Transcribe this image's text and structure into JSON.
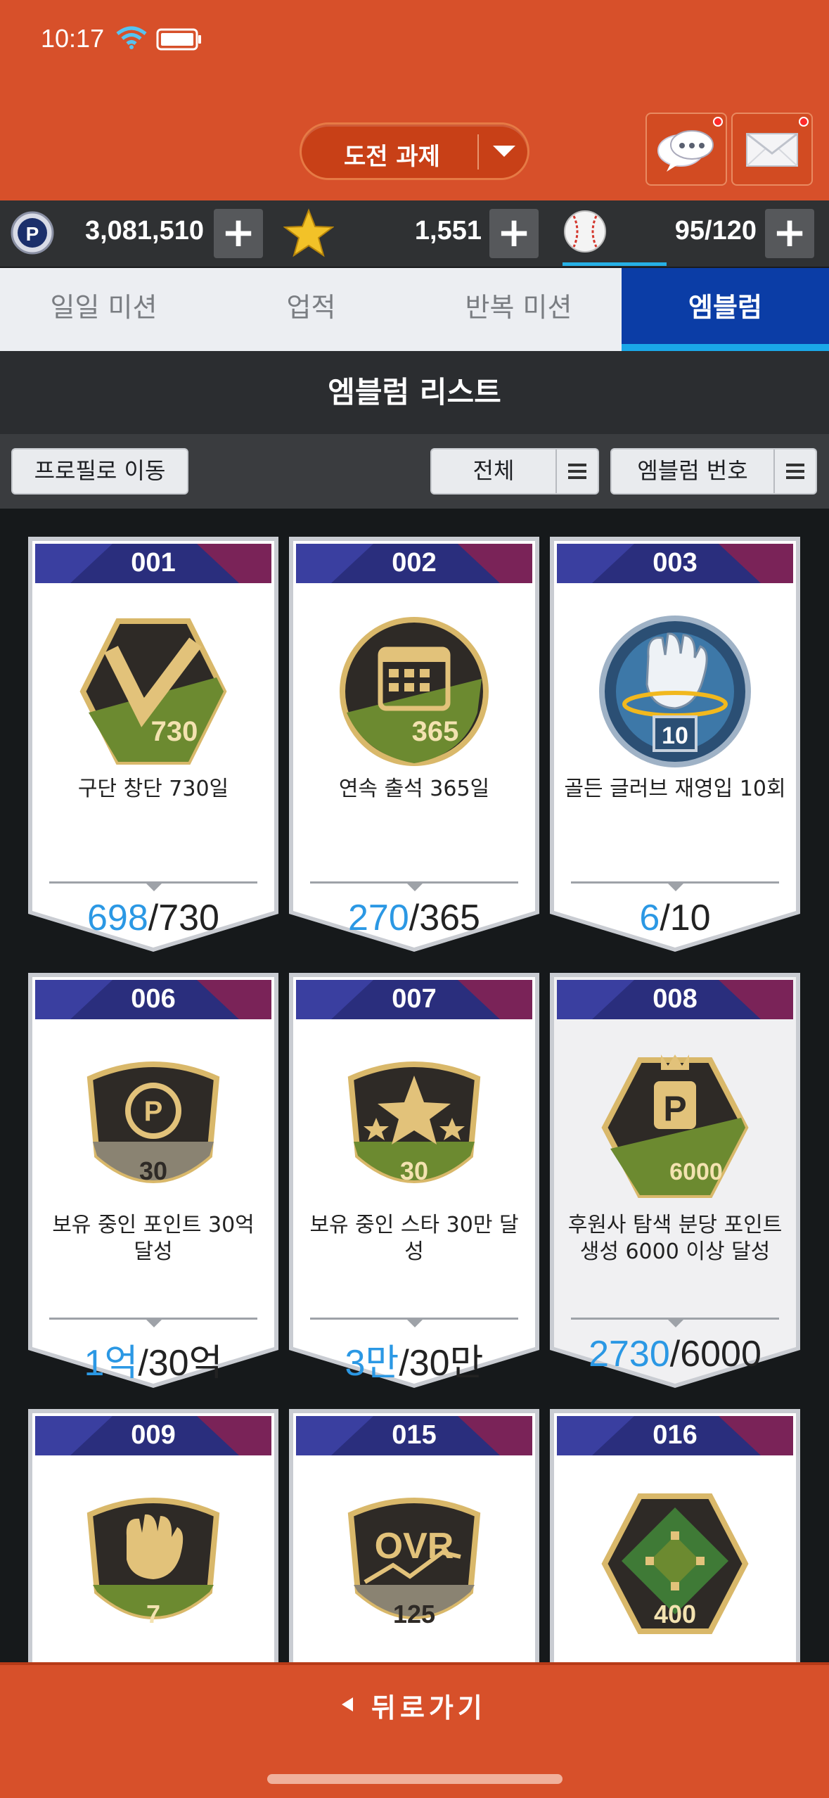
{
  "status": {
    "time": "10:17"
  },
  "header": {
    "challenge_label": "도전 과제",
    "chat_icon": "chat-bubbles-icon",
    "mail_icon": "envelope-icon"
  },
  "currency": {
    "points": "3,081,510",
    "stars": "1,551",
    "stamina": "95/120",
    "plus": "+"
  },
  "tabs": [
    {
      "label": "일일 미션",
      "active": false
    },
    {
      "label": "업적",
      "active": false
    },
    {
      "label": "반복 미션",
      "active": false
    },
    {
      "label": "엠블럼",
      "active": true
    }
  ],
  "list_title": "엠블럼 리스트",
  "filters": {
    "profile_button": "프로필로 이동",
    "category": "전체",
    "sort": "엠블럼 번호"
  },
  "cards": [
    {
      "number": "001",
      "title": "구단 창단 730일",
      "current": "698",
      "target": "/730",
      "emblem": "v-730-emblem-icon",
      "emblem_text": "730"
    },
    {
      "number": "002",
      "title": "연속 출석 365일",
      "current": "270",
      "target": "/365",
      "emblem": "calendar-365-emblem-icon",
      "emblem_text": "365"
    },
    {
      "number": "003",
      "title": "골든 글러브 재영입 10회",
      "current": "6",
      "target": "/10",
      "emblem": "glove-10-emblem-icon",
      "emblem_text": "10"
    },
    {
      "number": "006",
      "title": "보유 중인 포인트 30억 달성",
      "current": "1억",
      "target": "/30억",
      "emblem": "points-30-emblem-icon",
      "emblem_text": "30"
    },
    {
      "number": "007",
      "title": "보유 중인 스타 30만 달성",
      "current": "3만",
      "target": "/30만",
      "emblem": "star-30-emblem-icon",
      "emblem_text": "30"
    },
    {
      "number": "008",
      "title": "후원사 탐색 분당 포인트 생성 6000 이상 달성",
      "current": "2730",
      "target": "/6000",
      "emblem": "points-6000-emblem-icon",
      "emblem_text": "6000"
    },
    {
      "number": "009",
      "title": "",
      "current": "",
      "target": "",
      "emblem": "glove-7-emblem-icon",
      "emblem_text": "7"
    },
    {
      "number": "015",
      "title": "",
      "current": "",
      "target": "",
      "emblem": "ovr-125-emblem-icon",
      "emblem_text": "125"
    },
    {
      "number": "016",
      "title": "",
      "current": "",
      "target": "",
      "emblem": "field-400-emblem-icon",
      "emblem_text": "400"
    }
  ],
  "bottom": {
    "back_label": "뒤로가기"
  },
  "colors": {
    "header": "#d7502a",
    "tab_active": "#0b3da6",
    "progress_current": "#2b98e4"
  }
}
